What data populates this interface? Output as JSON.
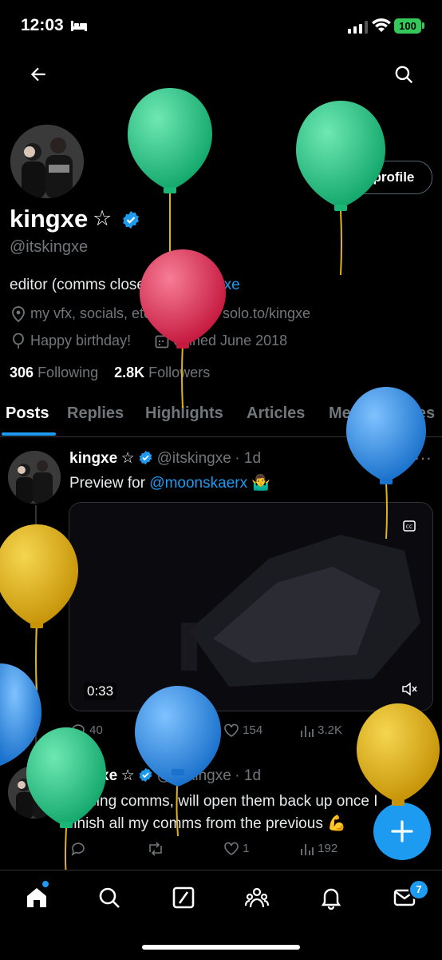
{
  "status_bar": {
    "time": "12:03",
    "battery": "100"
  },
  "profile": {
    "name": "kingxe",
    "star": "☆",
    "handle": "@itskingxe",
    "edit_label": "Edit profile",
    "bio_text": "editor (comms closed)",
    "bio_star": "★",
    "bio_mention": "@kingxe",
    "links_text": "my vfx, socials, etc... →",
    "link_url": "solo.to/kingxe",
    "birthday": "Happy birthday!",
    "joined": "Joined June 2018",
    "following_count": "306",
    "following_label": "Following",
    "followers_count": "2.8K",
    "followers_label": "Followers"
  },
  "tabs": [
    {
      "label": "Posts"
    },
    {
      "label": "Replies"
    },
    {
      "label": "Highlights"
    },
    {
      "label": "Articles"
    },
    {
      "label": "Media"
    },
    {
      "label": "Likes"
    }
  ],
  "posts": [
    {
      "name": "kingxe",
      "star": "☆",
      "handle": "@itskingxe",
      "time": "· 1d",
      "text_prefix": "Preview for",
      "mention": "@moonskaerx",
      "emoji": "🤷‍♂️",
      "video_time": "0:33",
      "replies": "40",
      "reposts": "13",
      "likes": "154",
      "views": "3.2K"
    },
    {
      "name": "kingxe",
      "star": "☆",
      "handle": "@itskingxe",
      "time": "· 1d",
      "text_line1": "closing comms, will open them back up once I",
      "text_line2": "finish all my comms from the previous",
      "emoji": "💪",
      "likes": "1",
      "views": "192"
    }
  ],
  "nav": {
    "messages_badge": "7"
  },
  "icons": [
    "back-icon",
    "search-icon",
    "verified-icon",
    "location-icon",
    "link-icon",
    "balloon-icon",
    "calendar-icon",
    "cc-icon",
    "mute-icon",
    "reply-icon",
    "repost-icon",
    "like-icon",
    "views-icon",
    "bookmark-icon",
    "share-icon",
    "compose-icon",
    "home-icon",
    "explore-icon",
    "grok-icon",
    "communities-icon",
    "notifications-icon",
    "messages-icon"
  ],
  "colors": {
    "accent": "#1d9bf0",
    "balloon_green": "#23c483",
    "balloon_red": "#e0365a",
    "balloon_blue": "#2f8fe6",
    "balloon_yellow": "#e0b21f"
  }
}
